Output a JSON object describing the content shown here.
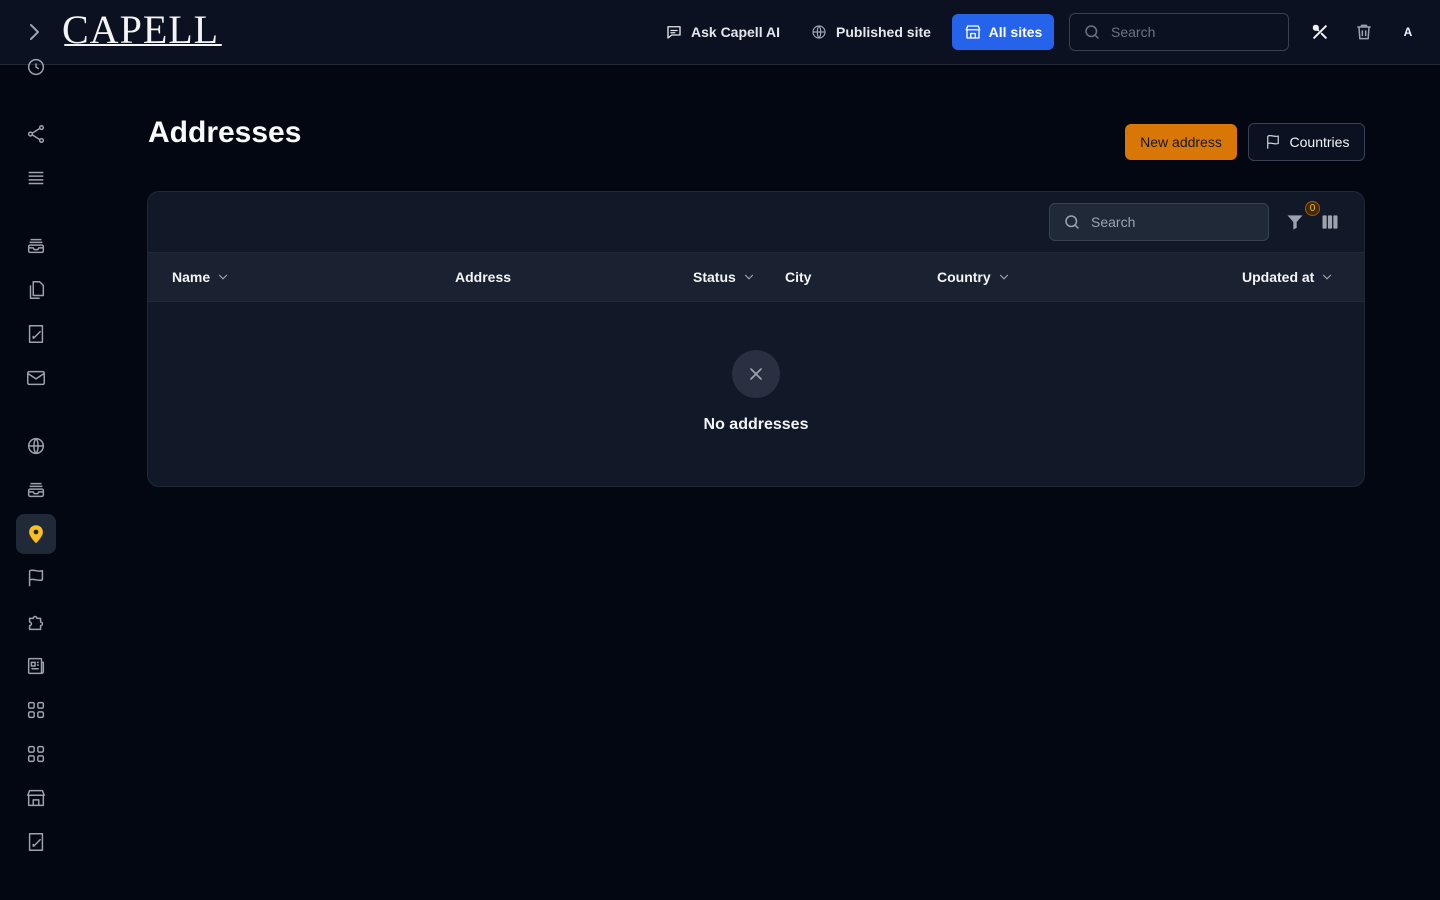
{
  "topbar": {
    "logo_text": "CAPELL",
    "ask_ai_label": "Ask Capell AI",
    "published_site_label": "Published site",
    "all_sites_label": "All sites",
    "search_placeholder": "Search",
    "avatar_initial": "A"
  },
  "sidebar": {
    "items": [
      {
        "icon": "clock-icon"
      },
      {
        "icon": "share-icon"
      },
      {
        "icon": "list-icon"
      },
      {
        "icon": "inbox-stack-icon"
      },
      {
        "icon": "documents-icon"
      },
      {
        "icon": "document-edit-icon"
      },
      {
        "icon": "mail-icon"
      },
      {
        "icon": "globe-icon"
      },
      {
        "icon": "inbox-stack-icon"
      },
      {
        "icon": "map-pin-icon",
        "active": true
      },
      {
        "icon": "flag-icon"
      },
      {
        "icon": "puzzle-icon"
      },
      {
        "icon": "newspaper-icon"
      },
      {
        "icon": "squares-icon"
      },
      {
        "icon": "squares-icon"
      },
      {
        "icon": "storefront-icon"
      },
      {
        "icon": "document-edit-icon"
      }
    ]
  },
  "page": {
    "title": "Addresses",
    "new_button_label": "New address",
    "countries_button_label": "Countries"
  },
  "table": {
    "search_placeholder": "Search",
    "filter_count": "0",
    "columns": [
      "Name",
      "Address",
      "Status",
      "City",
      "Country",
      "Updated at"
    ],
    "empty_message": "No addresses"
  },
  "colors": {
    "background": "#030712",
    "topbar": "#0b1120",
    "panel": "#111827",
    "primary_blue": "#2563eb",
    "accent_amber": "#d97706",
    "active_pin": "#fbbf24"
  }
}
